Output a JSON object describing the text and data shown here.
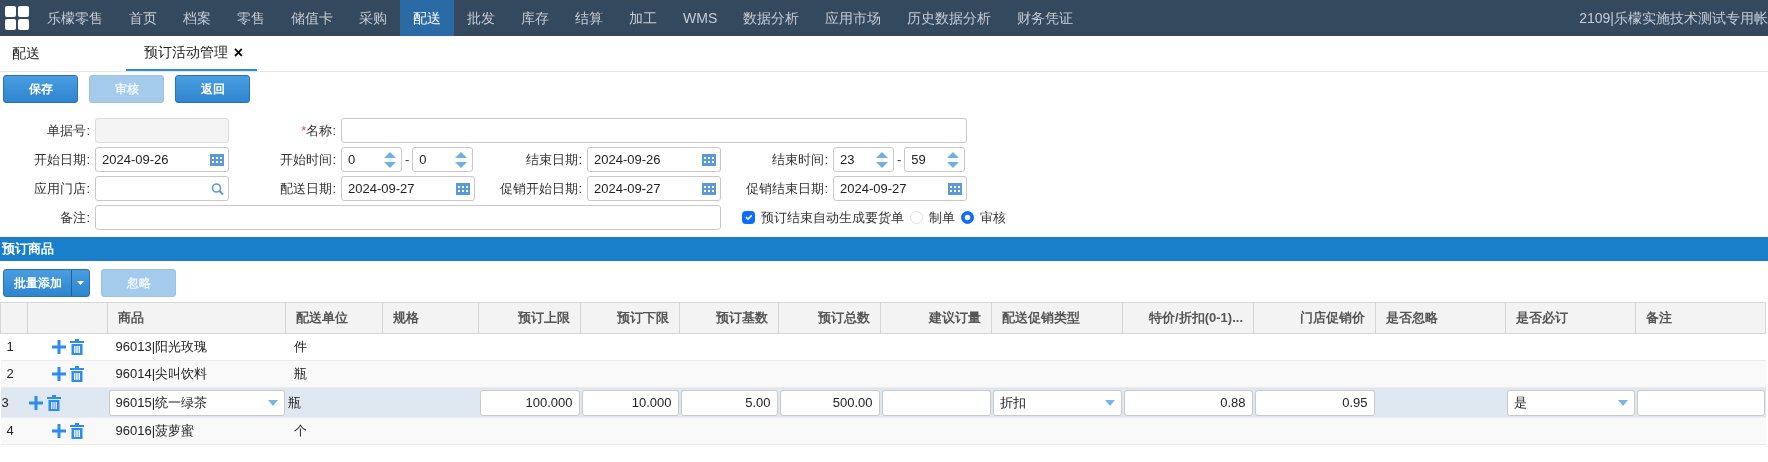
{
  "nav": {
    "items": [
      {
        "label": "乐檬零售",
        "selected": false
      },
      {
        "label": "首页",
        "selected": false
      },
      {
        "label": "档案",
        "selected": false
      },
      {
        "label": "零售",
        "selected": false
      },
      {
        "label": "储值卡",
        "selected": false
      },
      {
        "label": "采购",
        "selected": false
      },
      {
        "label": "配送",
        "selected": true
      },
      {
        "label": "批发",
        "selected": false
      },
      {
        "label": "库存",
        "selected": false
      },
      {
        "label": "结算",
        "selected": false
      },
      {
        "label": "加工",
        "selected": false
      },
      {
        "label": "WMS",
        "selected": false
      },
      {
        "label": "数据分析",
        "selected": false
      },
      {
        "label": "应用市场",
        "selected": false
      },
      {
        "label": "历史数据分析",
        "selected": false
      },
      {
        "label": "财务凭证",
        "selected": false
      }
    ],
    "account": "2109|乐檬实施技术测试专用帐"
  },
  "tabs": [
    {
      "label": "配送",
      "selected": false
    },
    {
      "label": "预订活动管理",
      "selected": true,
      "close": "×"
    }
  ],
  "toolbar": [
    {
      "label": "保存",
      "disabled": false
    },
    {
      "label": "审核",
      "disabled": true
    },
    {
      "label": "返回",
      "disabled": false
    }
  ],
  "form": {
    "rows": [
      [
        {
          "label": "单据号:",
          "kind": "text",
          "disabled": true
        },
        {
          "label": "名称:",
          "kind": "text",
          "required_mark": "*",
          "wide": true
        }
      ],
      [
        {
          "label": "开始日期:",
          "kind": "date",
          "value": "2024-09-26"
        },
        {
          "label": "开始时间:",
          "kind": "time",
          "values": [
            "0",
            "0"
          ],
          "separator": "-"
        },
        {
          "label": "结束日期:",
          "kind": "date",
          "value": "2024-09-26"
        },
        {
          "label": "结束时间:",
          "kind": "time",
          "values": [
            "23",
            "59"
          ],
          "separator": "-"
        }
      ],
      [
        {
          "label": "应用门店:",
          "kind": "search"
        },
        {
          "label": "配送日期:",
          "kind": "date",
          "value": "2024-09-27"
        },
        {
          "label": "促销开始日期:",
          "kind": "date",
          "value": "2024-09-27"
        },
        {
          "label": "促销结束日期:",
          "kind": "date",
          "value": "2024-09-27"
        }
      ],
      [
        {
          "label": "备注:",
          "kind": "text",
          "wide": true
        }
      ]
    ],
    "auto_order": {
      "label": "预订结束自动生成要货单",
      "checked": true
    },
    "status_options": [
      {
        "label": "制单",
        "selected": false
      },
      {
        "label": "审核",
        "selected": true
      }
    ]
  },
  "section": {
    "title": "预订商品",
    "buttons": [
      {
        "label": "批量添加",
        "kind": "split",
        "disabled": false
      },
      {
        "label": "忽略",
        "kind": "plain",
        "disabled": true
      }
    ],
    "table": {
      "columns": [
        {
          "label": "商品",
          "kind": "select"
        },
        {
          "label": "配送单位",
          "kind": "text"
        },
        {
          "label": "规格",
          "kind": "text"
        },
        {
          "label": "预订上限",
          "kind": "number"
        },
        {
          "label": "预订下限",
          "kind": "number"
        },
        {
          "label": "预订基数",
          "kind": "number"
        },
        {
          "label": "预订总数",
          "kind": "number"
        },
        {
          "label": "建议订量",
          "kind": "number"
        },
        {
          "label": "配送促销类型",
          "kind": "select"
        },
        {
          "label": "特价/折扣(0-1)...",
          "kind": "number"
        },
        {
          "label": "门店促销价",
          "kind": "number"
        },
        {
          "label": "是否忽略",
          "kind": "text"
        },
        {
          "label": "是否必订",
          "kind": "select"
        },
        {
          "label": "备注",
          "kind": "input"
        }
      ],
      "rows": [
        {
          "number": "1",
          "selected": false,
          "cells": [
            "96013|阳光玫瑰",
            "件"
          ]
        },
        {
          "number": "2",
          "selected": false,
          "cells": [
            "96014|尖叫饮料",
            "瓶"
          ]
        },
        {
          "number": "3",
          "selected": true,
          "cells": [
            "96015|统一绿茶",
            "瓶",
            null,
            "100.000",
            "10.000",
            "5.00",
            "500.00",
            null,
            "折扣",
            "0.88",
            "0.95",
            null,
            "是",
            null
          ]
        },
        {
          "number": "4",
          "selected": false,
          "cells": [
            "96016|菠萝蜜",
            "个"
          ]
        }
      ]
    }
  }
}
